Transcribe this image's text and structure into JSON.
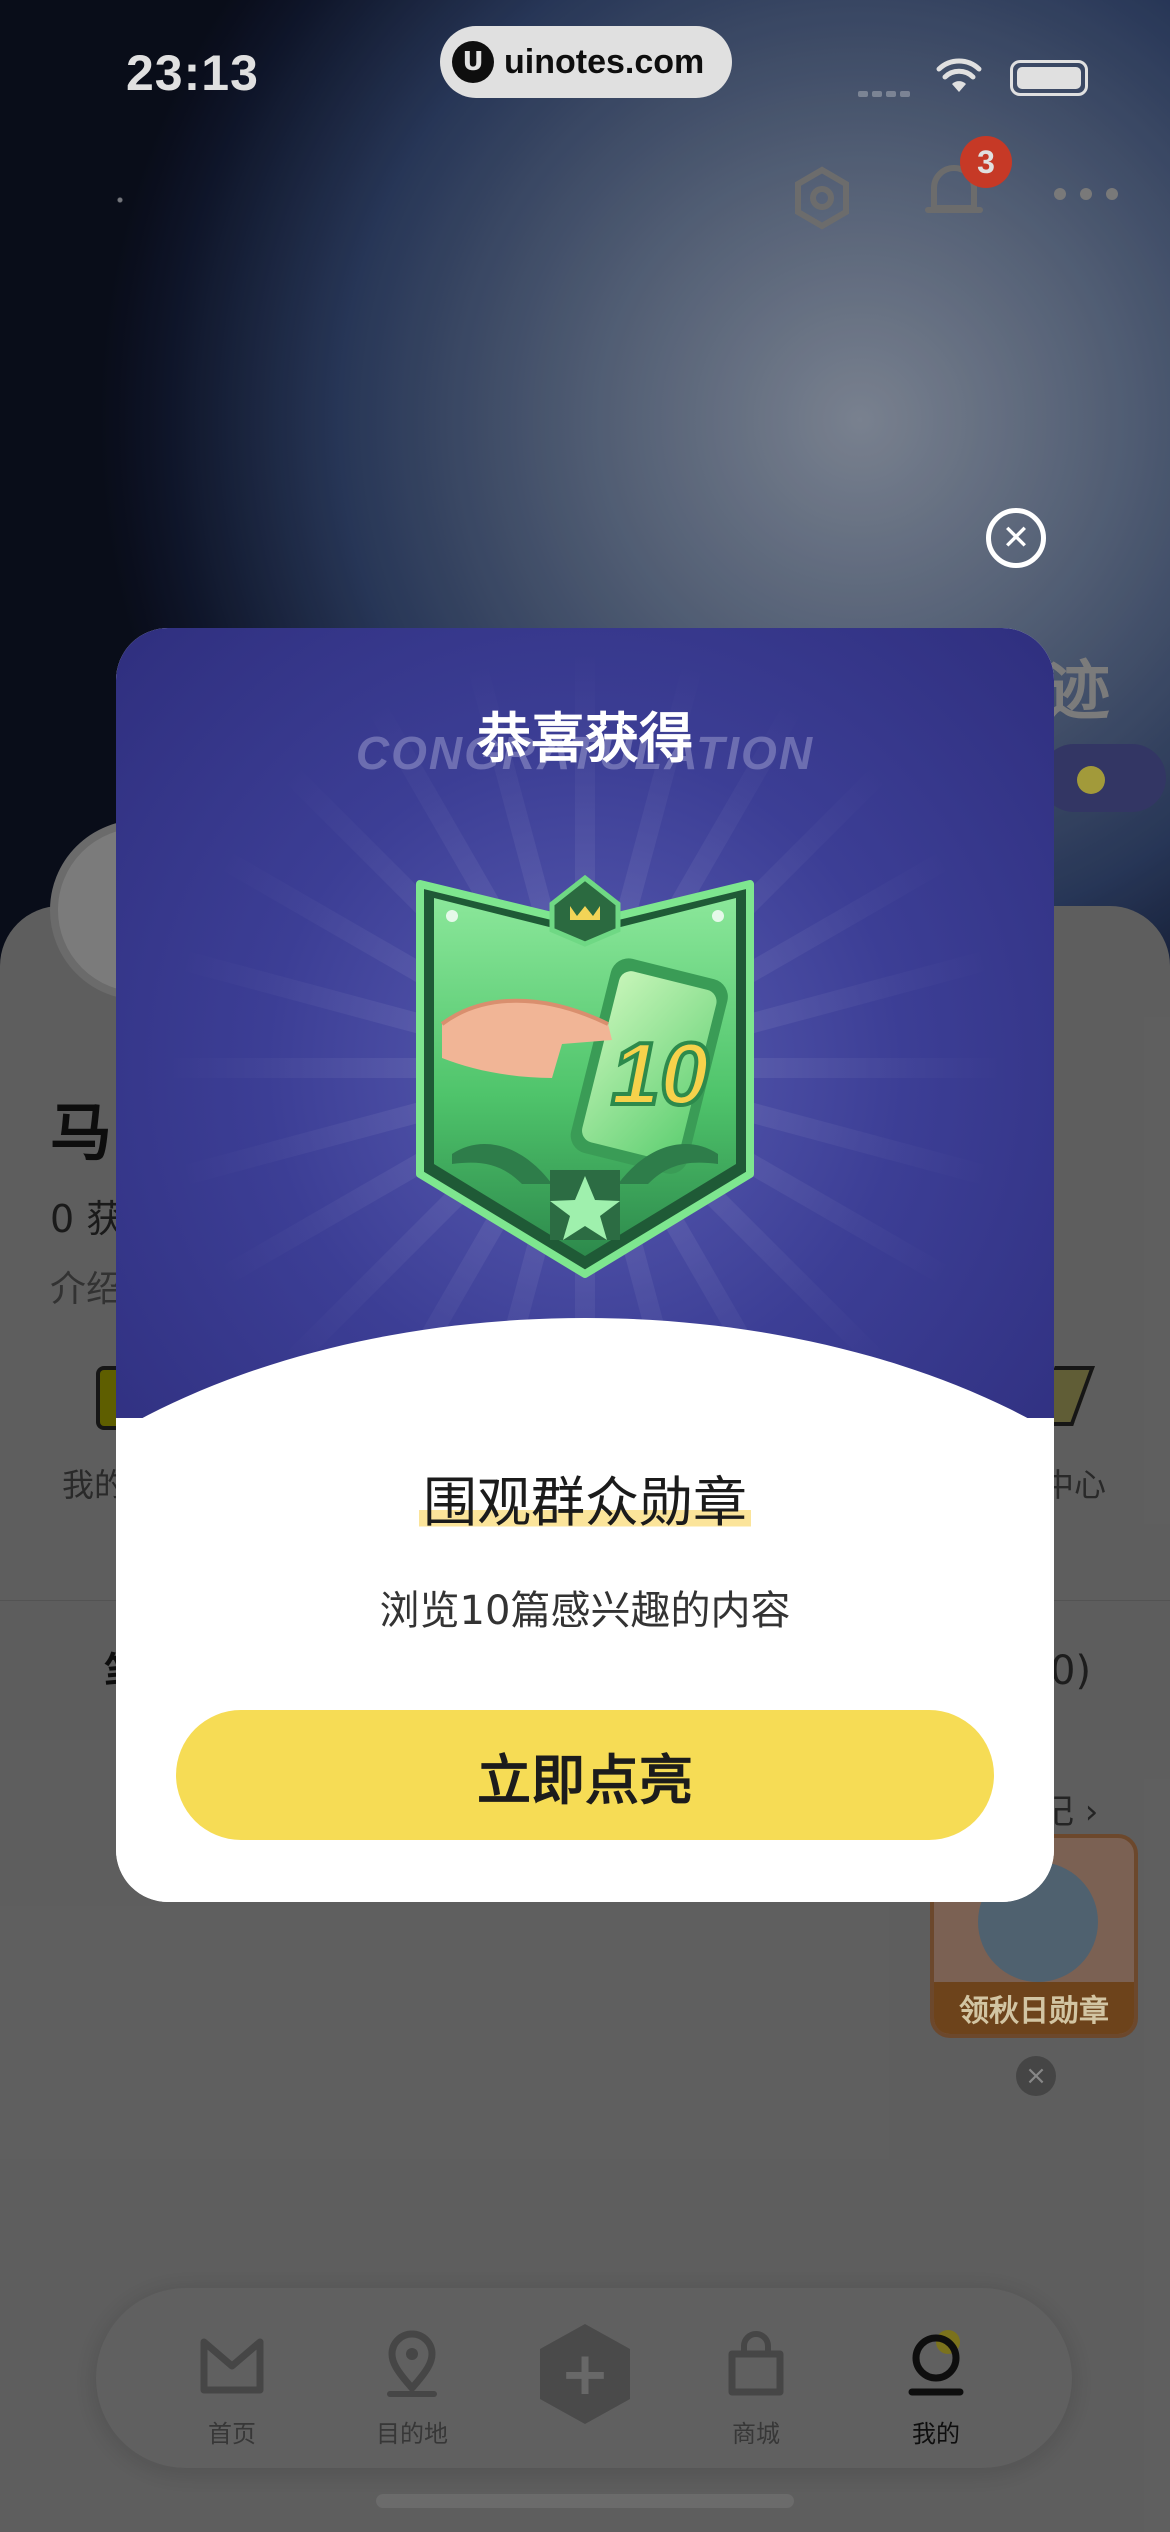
{
  "status_bar": {
    "time": "23:13",
    "url": "uinotes.com",
    "url_logo": "U"
  },
  "header": {
    "notification_count": "3",
    "icons": [
      "settings-icon",
      "bell-icon",
      "more-icon"
    ]
  },
  "background_page": {
    "title_fragment": "迹",
    "profile_name": "马",
    "stats_fragment": "0 获",
    "intro_fragment": "介绍",
    "feature_left_label": "我的",
    "feature_right_label": "中心",
    "tab_fragment": "笔",
    "right_fragment": "0)",
    "journal_link": "记 ›",
    "promo_card_label": "领秋日勋章"
  },
  "tab_bar": {
    "items": [
      {
        "label": "首页",
        "icon": "home-icon"
      },
      {
        "label": "目的地",
        "icon": "location-pin-icon"
      },
      {
        "label": "",
        "icon": "add-icon"
      },
      {
        "label": "商城",
        "icon": "shopping-bag-icon"
      },
      {
        "label": "我的",
        "icon": "profile-icon"
      }
    ],
    "active": "我的"
  },
  "modal": {
    "title": "恭喜获得",
    "subtitle_en": "CONGRATULATION",
    "badge_number": "10",
    "medal_name": "围观群众勋章",
    "medal_description": "浏览10篇感兴趣的内容",
    "cta_label": "立即点亮"
  },
  "colors": {
    "modal_top": "#3c3e95",
    "cta": "#f6dc55",
    "badge_green": "#5bd07a",
    "notification_badge": "#e2412c"
  }
}
